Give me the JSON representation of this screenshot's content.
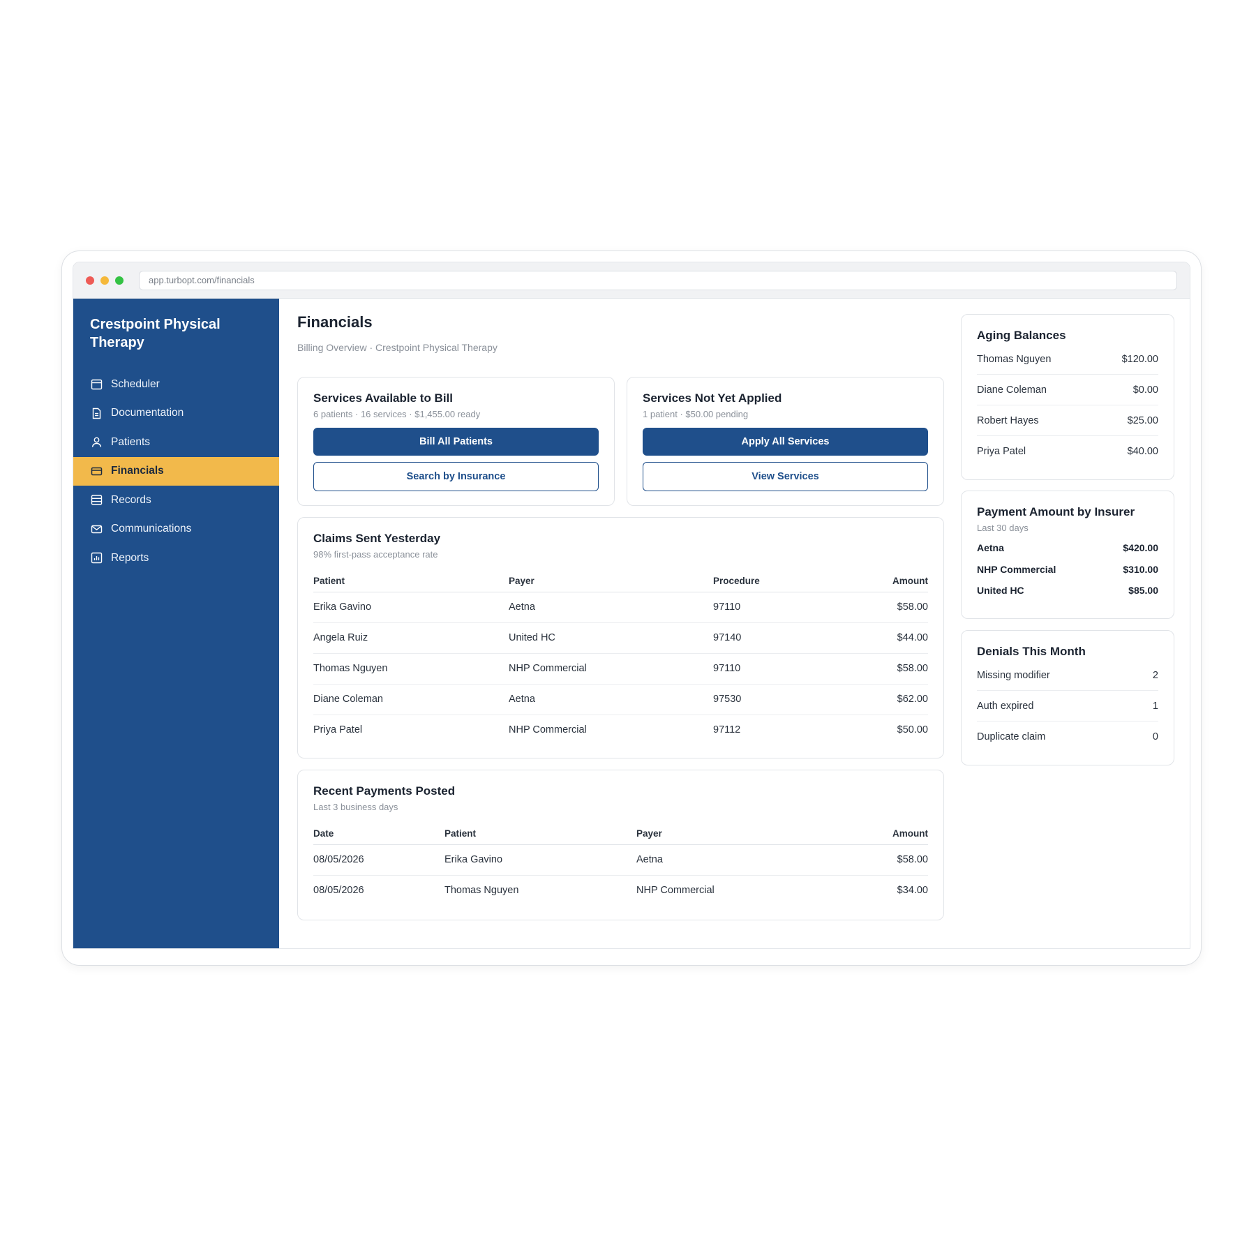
{
  "browser": {
    "url": "app.turbopt.com/financials"
  },
  "sidebar": {
    "brand": "Crestpoint Physical Therapy",
    "items": [
      {
        "label": "Scheduler",
        "icon": "calendar-icon"
      },
      {
        "label": "Documentation",
        "icon": "document-icon"
      },
      {
        "label": "Patients",
        "icon": "user-icon"
      },
      {
        "label": "Financials",
        "icon": "credit-card-icon",
        "active": true
      },
      {
        "label": "Records",
        "icon": "records-icon"
      },
      {
        "label": "Communications",
        "icon": "mail-icon"
      },
      {
        "label": "Reports",
        "icon": "report-chart-icon"
      }
    ]
  },
  "page": {
    "title": "Financials",
    "subtitle": "Billing Overview · Crestpoint Physical Therapy"
  },
  "bill_card": {
    "title": "Services Available to Bill",
    "subtitle": "6 patients · 16 services · $1,455.00 ready",
    "primary": "Bill All Patients",
    "secondary": "Search by Insurance"
  },
  "apply_card": {
    "title": "Services Not Yet Applied",
    "subtitle": "1 patient · $50.00 pending",
    "primary": "Apply All Services",
    "secondary": "View Services"
  },
  "claims": {
    "title": "Claims Sent Yesterday",
    "subtitle": "98% first-pass acceptance rate",
    "headers": [
      "Patient",
      "Payer",
      "Procedure",
      "Amount"
    ],
    "rows": [
      [
        "Erika Gavino",
        "Aetna",
        "97110",
        "$58.00"
      ],
      [
        "Angela Ruiz",
        "United HC",
        "97140",
        "$44.00"
      ],
      [
        "Thomas Nguyen",
        "NHP Commercial",
        "97110",
        "$58.00"
      ],
      [
        "Diane Coleman",
        "Aetna",
        "97530",
        "$62.00"
      ],
      [
        "Priya Patel",
        "NHP Commercial",
        "97112",
        "$50.00"
      ]
    ]
  },
  "payments": {
    "title": "Recent Payments Posted",
    "subtitle": "Last 3 business days",
    "headers": [
      "Date",
      "Patient",
      "Payer",
      "Amount"
    ],
    "rows": [
      [
        "08/05/2026",
        "Erika Gavino",
        "Aetna",
        "$58.00"
      ],
      [
        "08/05/2026",
        "Thomas Nguyen",
        "NHP Commercial",
        "$34.00"
      ]
    ]
  },
  "aging": {
    "title": "Aging Balances",
    "rows": [
      [
        "Thomas Nguyen",
        "$120.00"
      ],
      [
        "Diane Coleman",
        "$0.00"
      ],
      [
        "Robert Hayes",
        "$25.00"
      ],
      [
        "Priya Patel",
        "$40.00"
      ]
    ]
  },
  "insurer": {
    "title": "Payment Amount by Insurer",
    "subtitle": "Last 30 days",
    "rows": [
      [
        "Aetna",
        "$420.00"
      ],
      [
        "NHP Commercial",
        "$310.00"
      ],
      [
        "United HC",
        "$85.00"
      ]
    ]
  },
  "denials": {
    "title": "Denials This Month",
    "rows": [
      [
        "Missing modifier",
        "2"
      ],
      [
        "Auth expired",
        "1"
      ],
      [
        "Duplicate claim",
        "0"
      ]
    ]
  },
  "colors": {
    "brand_blue": "#1f4f8b",
    "active_yellow": "#f2b94b"
  }
}
